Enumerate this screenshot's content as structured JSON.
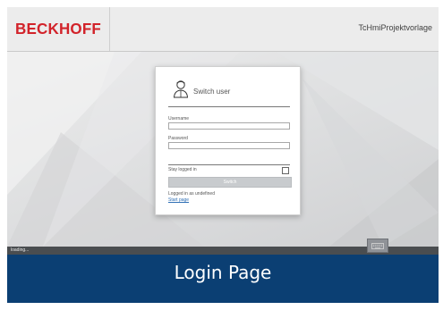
{
  "header": {
    "logo_text": "BECKHOFF",
    "project_title": "TcHmiProjektvorlage"
  },
  "login": {
    "title": "Switch user",
    "username_label": "Username",
    "username_value": "",
    "password_label": "Password",
    "password_value": "",
    "stay_logged_in_label": "Stay logged in",
    "stay_logged_in_checked": false,
    "switch_button_label": "Switch",
    "status_text": "Logged in as undefined",
    "start_page_link": "Start page",
    "user_icon": "user-icon"
  },
  "footer": {
    "status": "loading...",
    "keyboard_icon": "keyboard-icon"
  },
  "caption": {
    "text": "Login Page"
  },
  "colors": {
    "brand_red": "#d2232a",
    "caption_blue": "#0b3f73",
    "footer_gray": "#4a4d50",
    "button_gray": "#c8cbce",
    "link_blue": "#2f6fb5"
  }
}
